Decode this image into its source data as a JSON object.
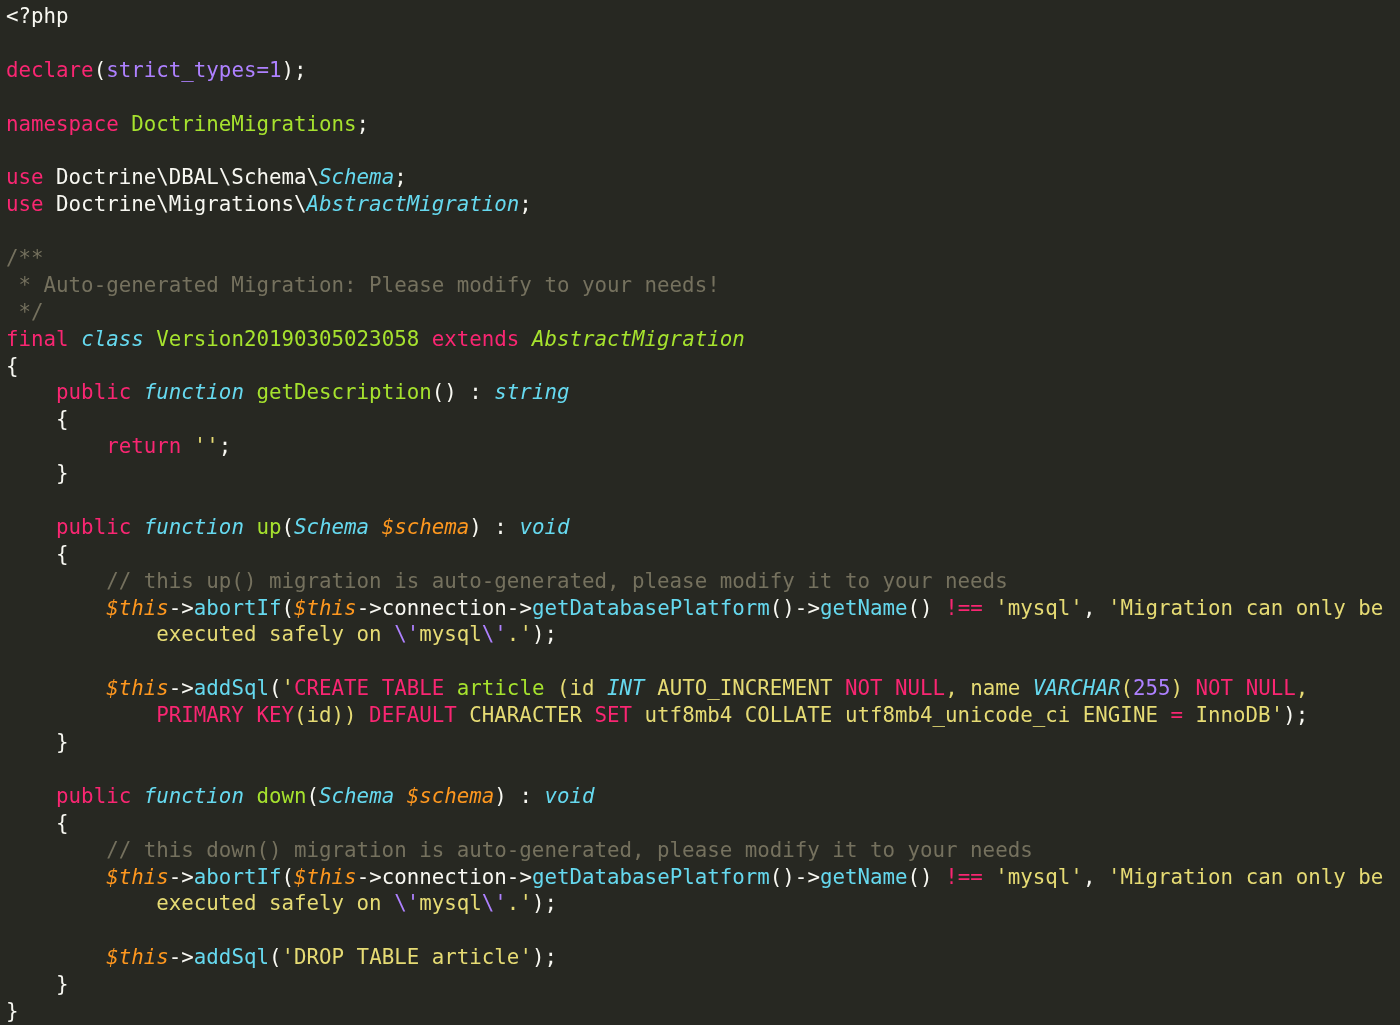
{
  "editor": {
    "lines": [
      {
        "kind": "code",
        "tokens": [
          {
            "kind": "plain",
            "text": "<?php"
          }
        ]
      },
      {
        "kind": "blank"
      },
      {
        "kind": "code",
        "tokens": [
          {
            "kind": "keyword",
            "text": "declare"
          },
          {
            "kind": "plain",
            "text": "("
          },
          {
            "kind": "constant",
            "text": "strict_types=1"
          },
          {
            "kind": "plain",
            "text": ");"
          }
        ]
      },
      {
        "kind": "blank"
      },
      {
        "kind": "code",
        "tokens": [
          {
            "kind": "keyword",
            "text": "namespace"
          },
          {
            "kind": "entity",
            "text": " DoctrineMigrations"
          },
          {
            "kind": "plain",
            "text": ";"
          }
        ]
      },
      {
        "kind": "blank"
      },
      {
        "kind": "code",
        "tokens": [
          {
            "kind": "keyword",
            "text": "use"
          },
          {
            "kind": "plain",
            "text": " Doctrine\\DBAL\\Schema\\"
          },
          {
            "kind": "type",
            "text": "Schema"
          },
          {
            "kind": "plain",
            "text": ";"
          }
        ]
      },
      {
        "kind": "code",
        "tokens": [
          {
            "kind": "keyword",
            "text": "use"
          },
          {
            "kind": "plain",
            "text": " Doctrine\\Migrations\\"
          },
          {
            "kind": "type",
            "text": "AbstractMigration"
          },
          {
            "kind": "plain",
            "text": ";"
          }
        ]
      },
      {
        "kind": "blank"
      },
      {
        "kind": "code",
        "tokens": [
          {
            "kind": "comment",
            "text": "/**"
          }
        ]
      },
      {
        "kind": "code",
        "tokens": [
          {
            "kind": "comment",
            "text": " * Auto-generated Migration: Please modify to your needs!"
          }
        ]
      },
      {
        "kind": "code",
        "tokens": [
          {
            "kind": "comment",
            "text": " */"
          }
        ]
      },
      {
        "kind": "code",
        "tokens": [
          {
            "kind": "keyword",
            "text": "final"
          },
          {
            "kind": "storage",
            "text": " class"
          },
          {
            "kind": "entity",
            "text": " Version20190305023058"
          },
          {
            "kind": "keyword",
            "text": " extends"
          },
          {
            "kind": "entity-italic",
            "text": " AbstractMigration"
          }
        ]
      },
      {
        "kind": "code",
        "tokens": [
          {
            "kind": "plain",
            "text": "{"
          }
        ]
      },
      {
        "kind": "code",
        "tokens": [
          {
            "kind": "keyword",
            "text": "    public"
          },
          {
            "kind": "storage",
            "text": " function"
          },
          {
            "kind": "entity",
            "text": " getDescription"
          },
          {
            "kind": "plain",
            "text": "() : "
          },
          {
            "kind": "type",
            "text": "string"
          }
        ]
      },
      {
        "kind": "code",
        "tokens": [
          {
            "kind": "plain",
            "text": "    {"
          }
        ]
      },
      {
        "kind": "code",
        "tokens": [
          {
            "kind": "keyword",
            "text": "        return"
          },
          {
            "kind": "string",
            "text": " ''"
          },
          {
            "kind": "plain",
            "text": ";"
          }
        ]
      },
      {
        "kind": "code",
        "tokens": [
          {
            "kind": "plain",
            "text": "    }"
          }
        ]
      },
      {
        "kind": "blank"
      },
      {
        "kind": "code",
        "tokens": [
          {
            "kind": "keyword",
            "text": "    public"
          },
          {
            "kind": "storage",
            "text": " function"
          },
          {
            "kind": "entity",
            "text": " up"
          },
          {
            "kind": "plain",
            "text": "("
          },
          {
            "kind": "type",
            "text": "Schema"
          },
          {
            "kind": "variable",
            "text": " $schema"
          },
          {
            "kind": "plain",
            "text": ") : "
          },
          {
            "kind": "type",
            "text": "void"
          }
        ]
      },
      {
        "kind": "code",
        "tokens": [
          {
            "kind": "plain",
            "text": "    {"
          }
        ]
      },
      {
        "kind": "code",
        "tokens": [
          {
            "kind": "comment",
            "text": "        // this up() migration is auto-generated, please modify it to your needs"
          }
        ]
      },
      {
        "kind": "code",
        "tokens": [
          {
            "kind": "variable",
            "text": "        $this"
          },
          {
            "kind": "plain",
            "text": "->"
          },
          {
            "kind": "function",
            "text": "abortIf"
          },
          {
            "kind": "plain",
            "text": "("
          },
          {
            "kind": "variable",
            "text": "$this"
          },
          {
            "kind": "plain",
            "text": "->connection->"
          },
          {
            "kind": "function",
            "text": "getDatabasePlatform"
          },
          {
            "kind": "plain",
            "text": "()->"
          },
          {
            "kind": "function",
            "text": "getName"
          },
          {
            "kind": "plain",
            "text": "() "
          },
          {
            "kind": "keyword",
            "text": "!=="
          },
          {
            "kind": "string",
            "text": " 'mysql'"
          },
          {
            "kind": "plain",
            "text": ", "
          },
          {
            "kind": "string",
            "text": "'Migration can only be"
          }
        ]
      },
      {
        "kind": "code",
        "tokens": [
          {
            "kind": "string",
            "text": "            executed safely on "
          },
          {
            "kind": "constant",
            "text": "\\'"
          },
          {
            "kind": "string",
            "text": "mysql"
          },
          {
            "kind": "constant",
            "text": "\\'"
          },
          {
            "kind": "string",
            "text": ".'"
          },
          {
            "kind": "plain",
            "text": ");"
          }
        ]
      },
      {
        "kind": "blank"
      },
      {
        "kind": "code",
        "tokens": [
          {
            "kind": "variable",
            "text": "        $this"
          },
          {
            "kind": "plain",
            "text": "->"
          },
          {
            "kind": "function",
            "text": "addSql"
          },
          {
            "kind": "plain",
            "text": "("
          },
          {
            "kind": "string",
            "text": "'"
          },
          {
            "kind": "keyword",
            "text": "CREATE"
          },
          {
            "kind": "keyword",
            "text": " TABLE"
          },
          {
            "kind": "entity",
            "text": " article"
          },
          {
            "kind": "string",
            "text": " (id "
          },
          {
            "kind": "type",
            "text": "INT"
          },
          {
            "kind": "string",
            "text": " AUTO_INCREMENT "
          },
          {
            "kind": "keyword",
            "text": "NOT NULL"
          },
          {
            "kind": "string",
            "text": ", name "
          },
          {
            "kind": "type",
            "text": "VARCHAR"
          },
          {
            "kind": "string",
            "text": "("
          },
          {
            "kind": "constant",
            "text": "255"
          },
          {
            "kind": "string",
            "text": ") "
          },
          {
            "kind": "keyword",
            "text": "NOT NULL"
          },
          {
            "kind": "string",
            "text": ","
          }
        ]
      },
      {
        "kind": "code",
        "tokens": [
          {
            "kind": "keyword",
            "text": "            PRIMARY KEY"
          },
          {
            "kind": "string",
            "text": "(id)) "
          },
          {
            "kind": "keyword",
            "text": "DEFAULT"
          },
          {
            "kind": "string",
            "text": " CHARACTER "
          },
          {
            "kind": "keyword",
            "text": "SET"
          },
          {
            "kind": "string",
            "text": " utf8mb4 COLLATE utf8mb4_unicode_ci ENGINE "
          },
          {
            "kind": "keyword",
            "text": "="
          },
          {
            "kind": "string",
            "text": " InnoDB'"
          },
          {
            "kind": "plain",
            "text": ");"
          }
        ]
      },
      {
        "kind": "code",
        "tokens": [
          {
            "kind": "plain",
            "text": "    }"
          }
        ]
      },
      {
        "kind": "blank"
      },
      {
        "kind": "code",
        "tokens": [
          {
            "kind": "keyword",
            "text": "    public"
          },
          {
            "kind": "storage",
            "text": " function"
          },
          {
            "kind": "entity",
            "text": " down"
          },
          {
            "kind": "plain",
            "text": "("
          },
          {
            "kind": "type",
            "text": "Schema"
          },
          {
            "kind": "variable",
            "text": " $schema"
          },
          {
            "kind": "plain",
            "text": ") : "
          },
          {
            "kind": "type",
            "text": "void"
          }
        ]
      },
      {
        "kind": "code",
        "tokens": [
          {
            "kind": "plain",
            "text": "    {"
          }
        ]
      },
      {
        "kind": "code",
        "tokens": [
          {
            "kind": "comment",
            "text": "        // this down() migration is auto-generated, please modify it to your needs"
          }
        ]
      },
      {
        "kind": "code",
        "tokens": [
          {
            "kind": "variable",
            "text": "        $this"
          },
          {
            "kind": "plain",
            "text": "->"
          },
          {
            "kind": "function",
            "text": "abortIf"
          },
          {
            "kind": "plain",
            "text": "("
          },
          {
            "kind": "variable",
            "text": "$this"
          },
          {
            "kind": "plain",
            "text": "->connection->"
          },
          {
            "kind": "function",
            "text": "getDatabasePlatform"
          },
          {
            "kind": "plain",
            "text": "()->"
          },
          {
            "kind": "function",
            "text": "getName"
          },
          {
            "kind": "plain",
            "text": "() "
          },
          {
            "kind": "keyword",
            "text": "!=="
          },
          {
            "kind": "string",
            "text": " 'mysql'"
          },
          {
            "kind": "plain",
            "text": ", "
          },
          {
            "kind": "string",
            "text": "'Migration can only be"
          }
        ]
      },
      {
        "kind": "code",
        "tokens": [
          {
            "kind": "string",
            "text": "            executed safely on "
          },
          {
            "kind": "constant",
            "text": "\\'"
          },
          {
            "kind": "string",
            "text": "mysql"
          },
          {
            "kind": "constant",
            "text": "\\'"
          },
          {
            "kind": "string",
            "text": ".'"
          },
          {
            "kind": "plain",
            "text": ");"
          }
        ]
      },
      {
        "kind": "blank"
      },
      {
        "kind": "code",
        "tokens": [
          {
            "kind": "variable",
            "text": "        $this"
          },
          {
            "kind": "plain",
            "text": "->"
          },
          {
            "kind": "function",
            "text": "addSql"
          },
          {
            "kind": "plain",
            "text": "("
          },
          {
            "kind": "string",
            "text": "'DROP TABLE article'"
          },
          {
            "kind": "plain",
            "text": ");"
          }
        ]
      },
      {
        "kind": "code",
        "tokens": [
          {
            "kind": "plain",
            "text": "    }"
          }
        ]
      },
      {
        "kind": "code",
        "tokens": [
          {
            "kind": "plain",
            "text": "}"
          }
        ]
      }
    ]
  }
}
